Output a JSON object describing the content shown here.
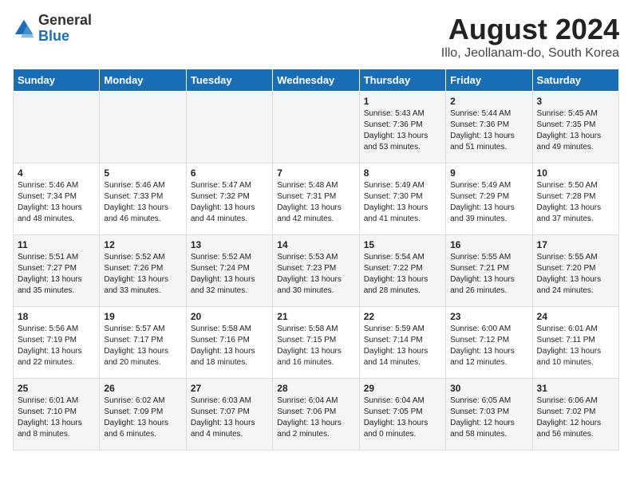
{
  "logo": {
    "general": "General",
    "blue": "Blue"
  },
  "title": "August 2024",
  "subtitle": "Illo, Jeollanam-do, South Korea",
  "days_of_week": [
    "Sunday",
    "Monday",
    "Tuesday",
    "Wednesday",
    "Thursday",
    "Friday",
    "Saturday"
  ],
  "weeks": [
    [
      {
        "day": "",
        "info": ""
      },
      {
        "day": "",
        "info": ""
      },
      {
        "day": "",
        "info": ""
      },
      {
        "day": "",
        "info": ""
      },
      {
        "day": "1",
        "info": "Sunrise: 5:43 AM\nSunset: 7:36 PM\nDaylight: 13 hours\nand 53 minutes."
      },
      {
        "day": "2",
        "info": "Sunrise: 5:44 AM\nSunset: 7:36 PM\nDaylight: 13 hours\nand 51 minutes."
      },
      {
        "day": "3",
        "info": "Sunrise: 5:45 AM\nSunset: 7:35 PM\nDaylight: 13 hours\nand 49 minutes."
      }
    ],
    [
      {
        "day": "4",
        "info": "Sunrise: 5:46 AM\nSunset: 7:34 PM\nDaylight: 13 hours\nand 48 minutes."
      },
      {
        "day": "5",
        "info": "Sunrise: 5:46 AM\nSunset: 7:33 PM\nDaylight: 13 hours\nand 46 minutes."
      },
      {
        "day": "6",
        "info": "Sunrise: 5:47 AM\nSunset: 7:32 PM\nDaylight: 13 hours\nand 44 minutes."
      },
      {
        "day": "7",
        "info": "Sunrise: 5:48 AM\nSunset: 7:31 PM\nDaylight: 13 hours\nand 42 minutes."
      },
      {
        "day": "8",
        "info": "Sunrise: 5:49 AM\nSunset: 7:30 PM\nDaylight: 13 hours\nand 41 minutes."
      },
      {
        "day": "9",
        "info": "Sunrise: 5:49 AM\nSunset: 7:29 PM\nDaylight: 13 hours\nand 39 minutes."
      },
      {
        "day": "10",
        "info": "Sunrise: 5:50 AM\nSunset: 7:28 PM\nDaylight: 13 hours\nand 37 minutes."
      }
    ],
    [
      {
        "day": "11",
        "info": "Sunrise: 5:51 AM\nSunset: 7:27 PM\nDaylight: 13 hours\nand 35 minutes."
      },
      {
        "day": "12",
        "info": "Sunrise: 5:52 AM\nSunset: 7:26 PM\nDaylight: 13 hours\nand 33 minutes."
      },
      {
        "day": "13",
        "info": "Sunrise: 5:52 AM\nSunset: 7:24 PM\nDaylight: 13 hours\nand 32 minutes."
      },
      {
        "day": "14",
        "info": "Sunrise: 5:53 AM\nSunset: 7:23 PM\nDaylight: 13 hours\nand 30 minutes."
      },
      {
        "day": "15",
        "info": "Sunrise: 5:54 AM\nSunset: 7:22 PM\nDaylight: 13 hours\nand 28 minutes."
      },
      {
        "day": "16",
        "info": "Sunrise: 5:55 AM\nSunset: 7:21 PM\nDaylight: 13 hours\nand 26 minutes."
      },
      {
        "day": "17",
        "info": "Sunrise: 5:55 AM\nSunset: 7:20 PM\nDaylight: 13 hours\nand 24 minutes."
      }
    ],
    [
      {
        "day": "18",
        "info": "Sunrise: 5:56 AM\nSunset: 7:19 PM\nDaylight: 13 hours\nand 22 minutes."
      },
      {
        "day": "19",
        "info": "Sunrise: 5:57 AM\nSunset: 7:17 PM\nDaylight: 13 hours\nand 20 minutes."
      },
      {
        "day": "20",
        "info": "Sunrise: 5:58 AM\nSunset: 7:16 PM\nDaylight: 13 hours\nand 18 minutes."
      },
      {
        "day": "21",
        "info": "Sunrise: 5:58 AM\nSunset: 7:15 PM\nDaylight: 13 hours\nand 16 minutes."
      },
      {
        "day": "22",
        "info": "Sunrise: 5:59 AM\nSunset: 7:14 PM\nDaylight: 13 hours\nand 14 minutes."
      },
      {
        "day": "23",
        "info": "Sunrise: 6:00 AM\nSunset: 7:12 PM\nDaylight: 13 hours\nand 12 minutes."
      },
      {
        "day": "24",
        "info": "Sunrise: 6:01 AM\nSunset: 7:11 PM\nDaylight: 13 hours\nand 10 minutes."
      }
    ],
    [
      {
        "day": "25",
        "info": "Sunrise: 6:01 AM\nSunset: 7:10 PM\nDaylight: 13 hours\nand 8 minutes."
      },
      {
        "day": "26",
        "info": "Sunrise: 6:02 AM\nSunset: 7:09 PM\nDaylight: 13 hours\nand 6 minutes."
      },
      {
        "day": "27",
        "info": "Sunrise: 6:03 AM\nSunset: 7:07 PM\nDaylight: 13 hours\nand 4 minutes."
      },
      {
        "day": "28",
        "info": "Sunrise: 6:04 AM\nSunset: 7:06 PM\nDaylight: 13 hours\nand 2 minutes."
      },
      {
        "day": "29",
        "info": "Sunrise: 6:04 AM\nSunset: 7:05 PM\nDaylight: 13 hours\nand 0 minutes."
      },
      {
        "day": "30",
        "info": "Sunrise: 6:05 AM\nSunset: 7:03 PM\nDaylight: 12 hours\nand 58 minutes."
      },
      {
        "day": "31",
        "info": "Sunrise: 6:06 AM\nSunset: 7:02 PM\nDaylight: 12 hours\nand 56 minutes."
      }
    ]
  ]
}
